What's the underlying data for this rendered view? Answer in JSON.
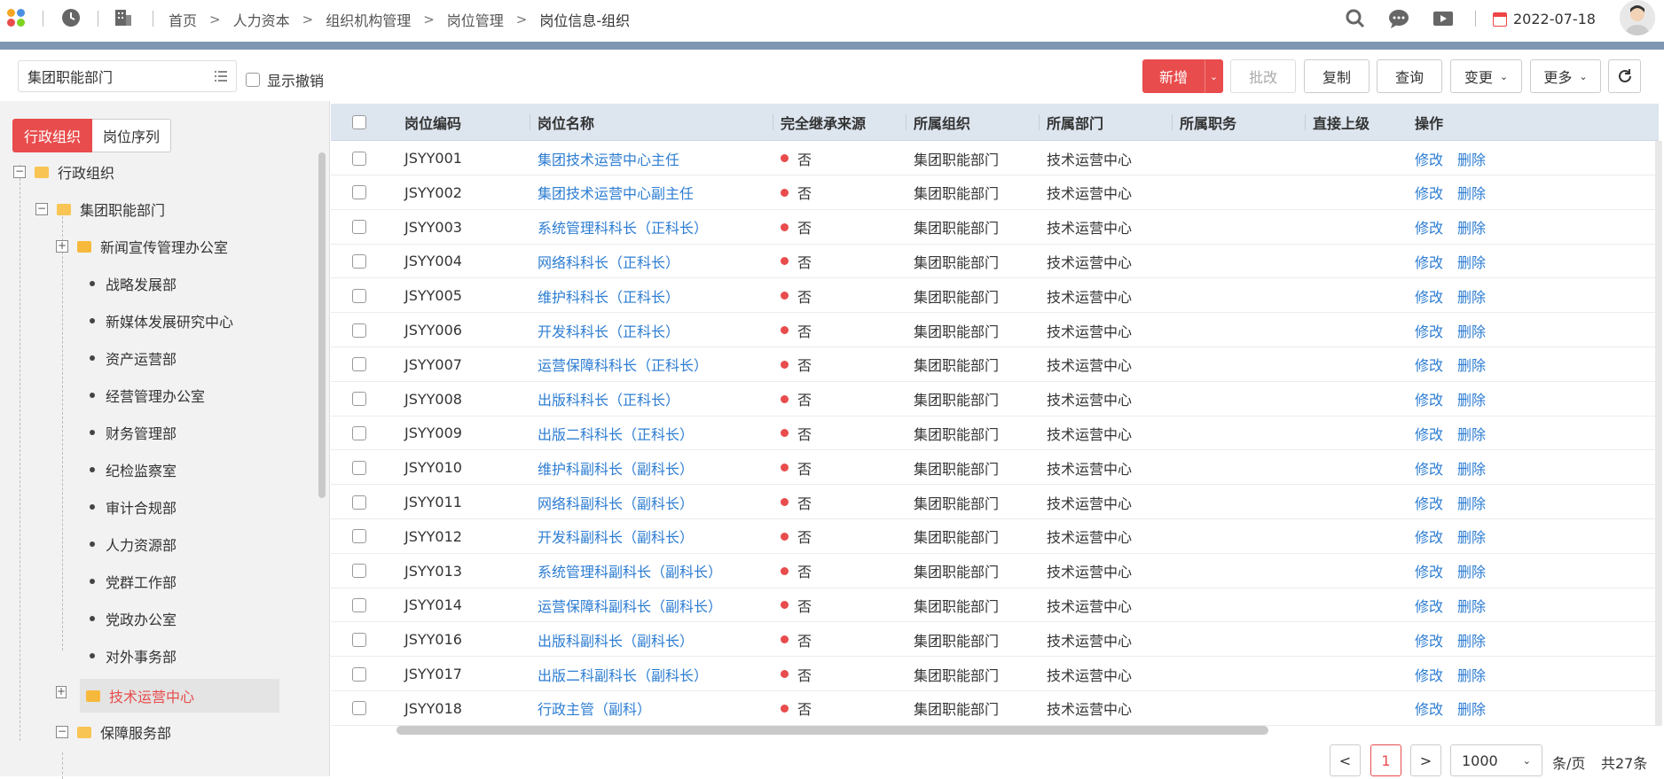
{
  "topbar": {
    "breadcrumb": [
      "首页",
      "人力资本",
      "组织机构管理",
      "岗位管理",
      "岗位信息-组织"
    ],
    "date": "2022-07-18",
    "icons": [
      "logo-icon",
      "clock-icon",
      "building-icon",
      "search-icon",
      "chat-icon",
      "video-icon",
      "calendar-icon",
      "avatar"
    ]
  },
  "toolbar": {
    "org_value": "集团职能部门",
    "show_revoked": "显示撤销",
    "btn_add": "新增",
    "btn_batch": "批改",
    "btn_copy": "复制",
    "btn_query": "查询",
    "btn_change": "变更",
    "btn_more": "更多"
  },
  "left": {
    "tab_admin": "行政组织",
    "tab_seq": "岗位序列",
    "tree": [
      "行政组织",
      "集团职能部门",
      "新闻宣传管理办公室",
      "战略发展部",
      "新媒体发展研究中心",
      "资产运营部",
      "经营管理办公室",
      "财务管理部",
      "纪检监察室",
      "审计合规部",
      "人力资源部",
      "党群工作部",
      "党政办公室",
      "对外事务部",
      "技术运营中心",
      "保障服务部"
    ]
  },
  "table": {
    "headers": [
      "岗位编码",
      "岗位名称",
      "完全继承来源",
      "所属组织",
      "所属部门",
      "所属职务",
      "直接上级",
      "操作"
    ],
    "edit": "修改",
    "del": "删除",
    "rows": [
      {
        "code": "JSYY001",
        "name": "集团技术运营中心主任",
        "inherit": "否",
        "org": "集团职能部门",
        "dept": "技术运营中心"
      },
      {
        "code": "JSYY002",
        "name": "集团技术运营中心副主任",
        "inherit": "否",
        "org": "集团职能部门",
        "dept": "技术运营中心"
      },
      {
        "code": "JSYY003",
        "name": "系统管理科科长（正科长）",
        "inherit": "否",
        "org": "集团职能部门",
        "dept": "技术运营中心"
      },
      {
        "code": "JSYY004",
        "name": "网络科科长（正科长）",
        "inherit": "否",
        "org": "集团职能部门",
        "dept": "技术运营中心"
      },
      {
        "code": "JSYY005",
        "name": "维护科科长（正科长）",
        "inherit": "否",
        "org": "集团职能部门",
        "dept": "技术运营中心"
      },
      {
        "code": "JSYY006",
        "name": "开发科科长（正科长）",
        "inherit": "否",
        "org": "集团职能部门",
        "dept": "技术运营中心"
      },
      {
        "code": "JSYY007",
        "name": "运营保障科科长（正科长）",
        "inherit": "否",
        "org": "集团职能部门",
        "dept": "技术运营中心"
      },
      {
        "code": "JSYY008",
        "name": "出版科科长（正科长）",
        "inherit": "否",
        "org": "集团职能部门",
        "dept": "技术运营中心"
      },
      {
        "code": "JSYY009",
        "name": "出版二科科长（正科长）",
        "inherit": "否",
        "org": "集团职能部门",
        "dept": "技术运营中心"
      },
      {
        "code": "JSYY010",
        "name": "维护科副科长（副科长）",
        "inherit": "否",
        "org": "集团职能部门",
        "dept": "技术运营中心"
      },
      {
        "code": "JSYY011",
        "name": "网络科副科长（副科长）",
        "inherit": "否",
        "org": "集团职能部门",
        "dept": "技术运营中心"
      },
      {
        "code": "JSYY012",
        "name": "开发科副科长（副科长）",
        "inherit": "否",
        "org": "集团职能部门",
        "dept": "技术运营中心"
      },
      {
        "code": "JSYY013",
        "name": "系统管理科副科长（副科长）",
        "inherit": "否",
        "org": "集团职能部门",
        "dept": "技术运营中心"
      },
      {
        "code": "JSYY014",
        "name": "运营保障科副科长（副科长）",
        "inherit": "否",
        "org": "集团职能部门",
        "dept": "技术运营中心"
      },
      {
        "code": "JSYY016",
        "name": "出版科副科长（副科长）",
        "inherit": "否",
        "org": "集团职能部门",
        "dept": "技术运营中心"
      },
      {
        "code": "JSYY017",
        "name": "出版二科副科长（副科长）",
        "inherit": "否",
        "org": "集团职能部门",
        "dept": "技术运营中心"
      },
      {
        "code": "JSYY018",
        "name": "行政主管（副科）",
        "inherit": "否",
        "org": "集团职能部门",
        "dept": "技术运营中心"
      }
    ]
  },
  "pager": {
    "prev": "<",
    "page": "1",
    "next": ">",
    "size": "1000",
    "unit": "条/页",
    "total": "共27条"
  },
  "colors": {
    "accent": "#e84c4c",
    "link": "#2d7dd2",
    "header_bg": "#dde5ef",
    "bar": "#7f96b2"
  }
}
